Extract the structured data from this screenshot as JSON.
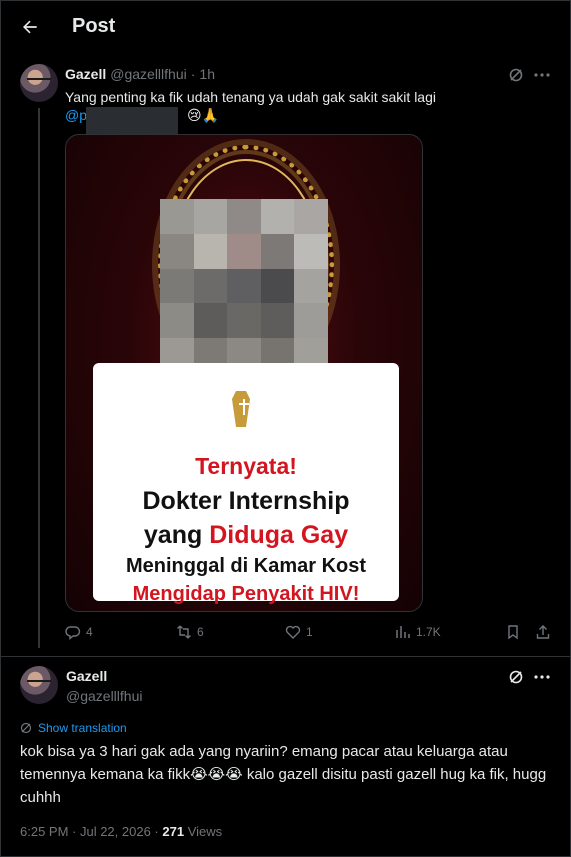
{
  "header": {
    "title": "Post",
    "back_icon": "arrow-left-icon"
  },
  "tweet": {
    "display_name": "Gazell",
    "handle": "@gazelllfhui",
    "separator": "·",
    "time": "1h",
    "text": "Yang penting ka fik udah tenang ya udah gak sakit sakit lagi",
    "mention": "@p",
    "mention_emoji": "😢🙏",
    "media": {
      "line1": "Ternyata!",
      "line2": "Dokter Internship",
      "line3_prefix": "yang ",
      "line3_red": "Diduga Gay",
      "line4": "Meninggal di Kamar Kost",
      "line5": "Mengidap Penyakit HIV!"
    },
    "actions": {
      "replies": "4",
      "reposts": "6",
      "likes": "1",
      "views": "1.7K"
    }
  },
  "reply": {
    "display_name": "Gazell",
    "handle": "@gazelllfhui",
    "show_translation": "Show translation",
    "text": "kok bisa ya 3 hari gak ada yang nyariin? emang pacar atau keluarga atau temennya kemana ka fikk😭😭😭 kalo gazell disitu pasti gazell hug ka fik, hugg cuhhh",
    "time": "6:25 PM · Jul 22, 2026 ·",
    "views_count": "271",
    "views_label": "Views"
  },
  "colors": {
    "accent": "#1d9bf0",
    "muted": "#71767b",
    "headline_red": "#d2151f",
    "background": "#000000"
  }
}
